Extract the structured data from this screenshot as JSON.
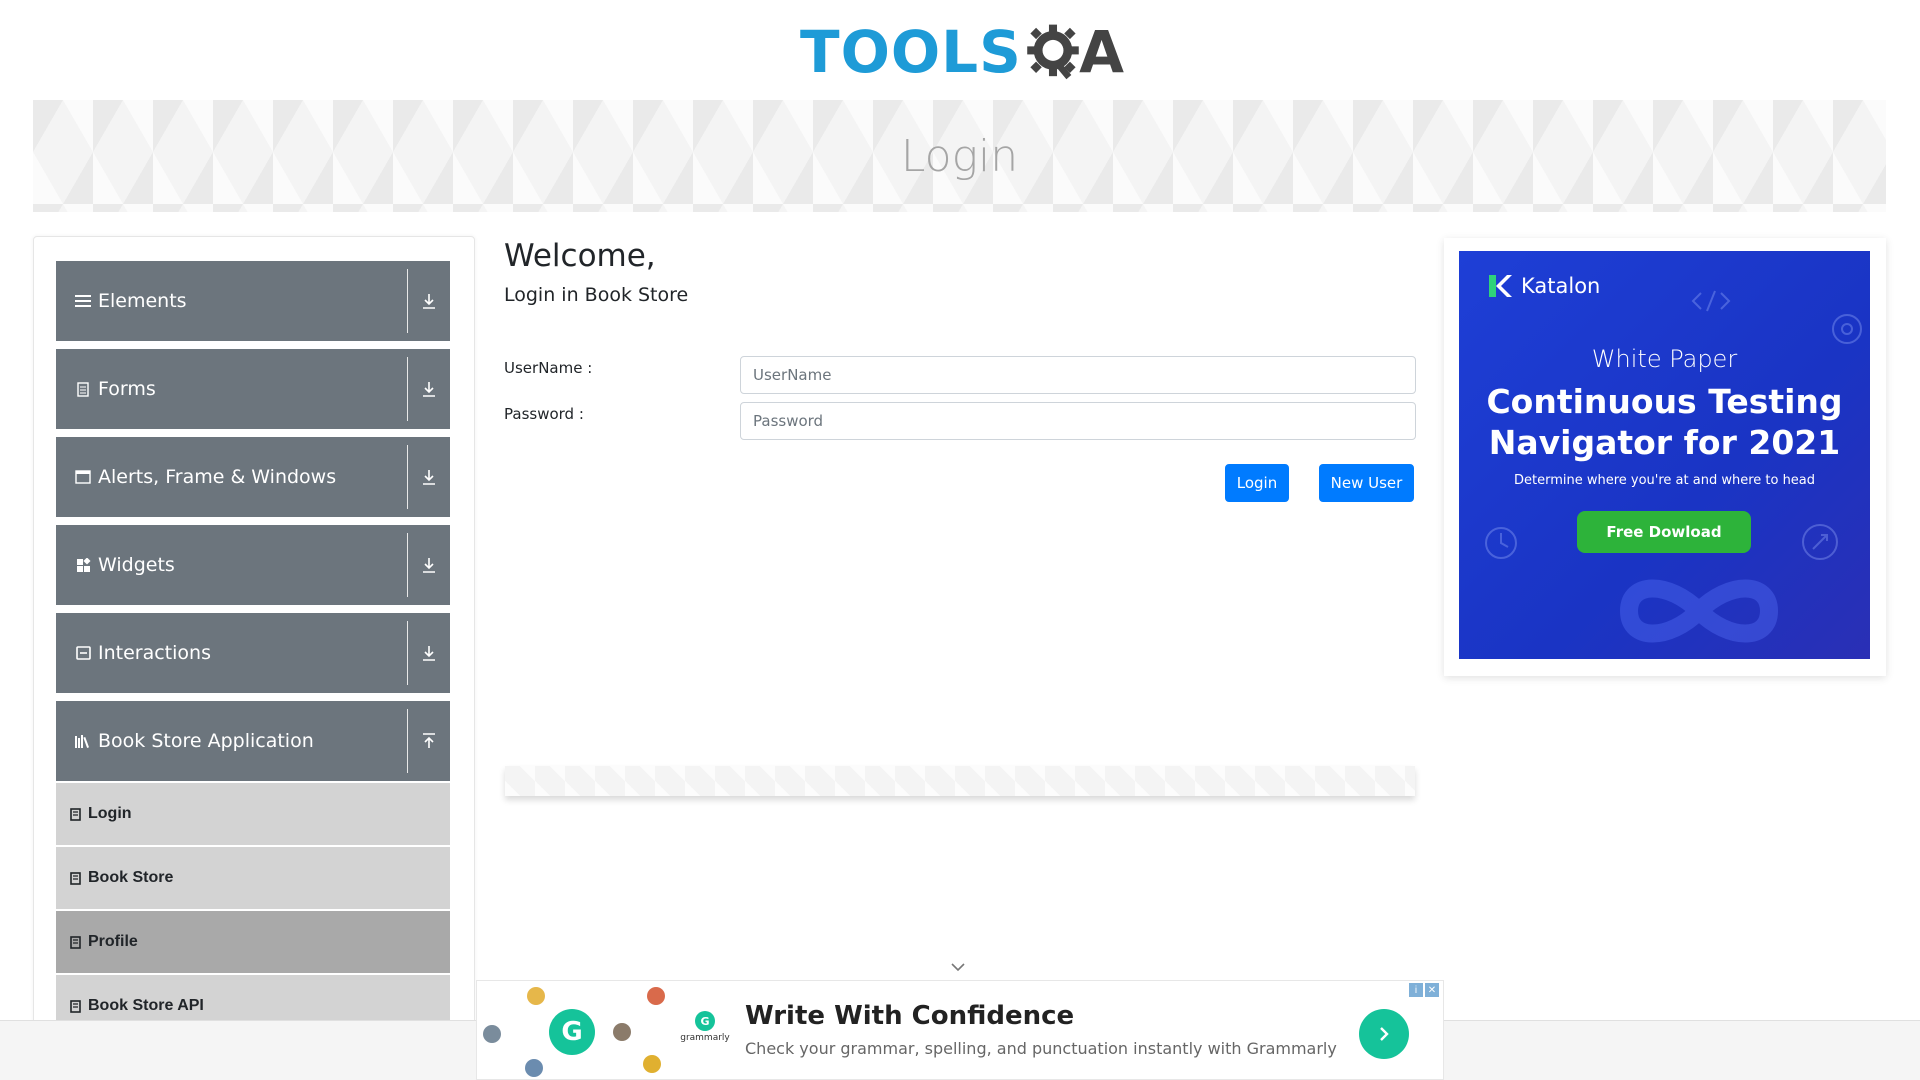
{
  "header": {
    "logo_tools": "TOOLS",
    "logo_qa_a": "A"
  },
  "banner": {
    "title": "Login"
  },
  "sidebar": {
    "groups": [
      {
        "label": "Elements",
        "icon": "menu-icon",
        "state": "collapsed"
      },
      {
        "label": "Forms",
        "icon": "document-icon",
        "state": "collapsed"
      },
      {
        "label": "Alerts, Frame & Windows",
        "icon": "window-icon",
        "state": "collapsed"
      },
      {
        "label": "Widgets",
        "icon": "widgets-icon",
        "state": "collapsed"
      },
      {
        "label": "Interactions",
        "icon": "interactions-icon",
        "state": "collapsed"
      },
      {
        "label": "Book Store Application",
        "icon": "books-icon",
        "state": "expanded"
      }
    ],
    "book_items": [
      {
        "label": "Login",
        "active": false
      },
      {
        "label": "Book Store",
        "active": false
      },
      {
        "label": "Profile",
        "active": true
      },
      {
        "label": "Book Store API",
        "active": false
      }
    ]
  },
  "main": {
    "welcome": "Welcome,",
    "subtitle": "Login in Book Store",
    "username_label": "UserName :",
    "username_placeholder": "UserName",
    "username_value": "",
    "password_label": "Password :",
    "password_placeholder": "Password",
    "password_value": "",
    "login_button": "Login",
    "new_user_button": "New User"
  },
  "right_ad": {
    "brand": "Katalon",
    "kicker": "White Paper",
    "title_line1": "Continuous Testing",
    "title_line2": "Navigator for 2021",
    "subtitle": "Determine where you're at and where to head",
    "cta": "Free Dowload",
    "colors": {
      "background": "#1e3fd6",
      "cta": "#2db33a"
    }
  },
  "bottom_ad": {
    "title": "Write With Confidence",
    "description": "Check your grammar, spelling, and punctuation instantly with Grammarly",
    "brand": "grammarly",
    "logo_letter": "G",
    "colors": {
      "accent": "#15c39a"
    }
  },
  "colors": {
    "primary_button": "#007bff",
    "sidebar_group": "#6c757d",
    "sidebar_item": "#d3d3d3",
    "sidebar_item_active": "#a9a9a9",
    "logo_blue": "#1e9bd7"
  }
}
